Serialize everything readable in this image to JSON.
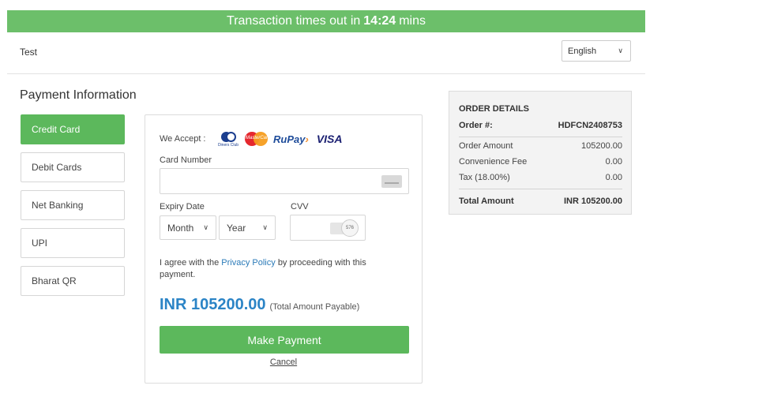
{
  "timer": {
    "prefix": "Transaction times out in",
    "time": "14:24",
    "suffix": "mins"
  },
  "merchant": {
    "name": "Test"
  },
  "language": {
    "selected": "English"
  },
  "payment_info": {
    "title": "Payment Information",
    "tabs": [
      {
        "label": "Credit Card",
        "active": true
      },
      {
        "label": "Debit Cards"
      },
      {
        "label": "Net Banking"
      },
      {
        "label": "UPI"
      },
      {
        "label": "Bharat QR"
      }
    ]
  },
  "card_form": {
    "we_accept": "We Accept :",
    "logos": {
      "diners": "Diners Club",
      "mastercard": "MasterCard",
      "rupay_a": "RuPay",
      "rupay_b": "›",
      "visa": "VISA"
    },
    "card_number_label": "Card Number",
    "card_number_value": "",
    "expiry_label": "Expiry Date",
    "month_selected": "Month",
    "year_selected": "Year",
    "cvv_label": "CVV",
    "cvv_value": "",
    "cvv_hint": "576",
    "agree_pre": "I agree with the",
    "agree_link": "Privacy Policy",
    "agree_post": "by proceeding with this payment.",
    "amount": "INR 105200.00",
    "amount_note": "(Total Amount Payable)",
    "pay_button": "Make Payment",
    "cancel": "Cancel"
  },
  "order_details": {
    "title": "ORDER DETAILS",
    "order_no_label": "Order #:",
    "order_no": "HDFCN2408753",
    "rows": [
      {
        "label": "Order  Amount",
        "value": "105200.00"
      },
      {
        "label": "Convenience Fee",
        "value": "0.00"
      },
      {
        "label": "Tax (18.00%)",
        "value": "0.00"
      }
    ],
    "total_label": "Total Amount",
    "total_value": "INR 105200.00"
  },
  "colors": {
    "accent_green": "#5cb85c",
    "timer_green": "#6cbf6a",
    "amount_blue": "#2b84c6",
    "link_blue": "#2a7ab8"
  },
  "icons": {
    "card": "credit-card-icon",
    "cvv": "cvv-card-icon",
    "chevron": "chevron-down-icon"
  }
}
